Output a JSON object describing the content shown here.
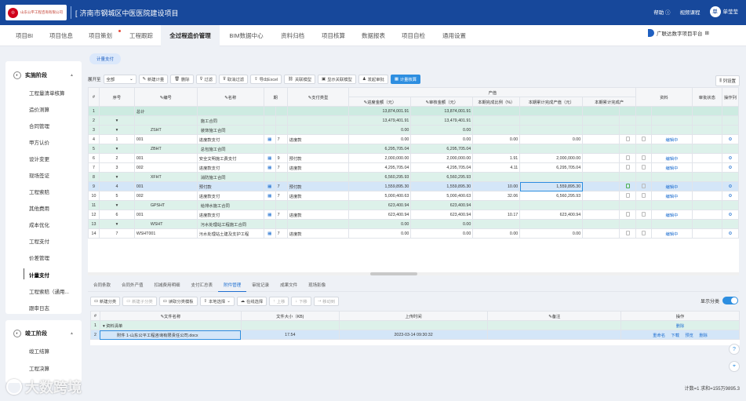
{
  "header": {
    "logo_text": "山东公平工程咨询有限公司",
    "project_title": "济南市钢城区中医医院建设项目",
    "help": "帮助",
    "video": "视频课程",
    "user": "单莹莹",
    "avatar": "单",
    "platform": "广联达数字项目平台"
  },
  "main_tabs": [
    {
      "label": "项目BI"
    },
    {
      "label": "项目信息"
    },
    {
      "label": "项目策划"
    },
    {
      "label": "工程跟踪"
    },
    {
      "label": "全过程造价管理"
    },
    {
      "label": "BIM数据中心"
    },
    {
      "label": "资料归档"
    },
    {
      "label": "项目核算"
    },
    {
      "label": "数据报表"
    },
    {
      "label": "项目自检"
    },
    {
      "label": "通用设置"
    }
  ],
  "sidebar": {
    "group1": "实施阶段",
    "items": [
      "工程量清单核算",
      "造价测算",
      "合同管理",
      "甲方认价",
      "设计变更",
      "现场签证",
      "工程索赔",
      "其他费用",
      "成本优化",
      "工程支付",
      "价差管理",
      "计量支付",
      "工程索赔（通用...",
      "跟审日志"
    ],
    "group2": "竣工阶段",
    "items2": [
      "竣工结算",
      "工程决算"
    ]
  },
  "breadcrumb_tab": "计量支付",
  "toolbar": {
    "expand_label": "展开至",
    "expand_value": "全部",
    "buttons": [
      "新建计量",
      "删除",
      "过滤",
      "取消过滤",
      "导出Excel",
      "关联模型",
      "显示关联模型",
      "发起审批",
      "计量核算"
    ],
    "column_settings": "列设置"
  },
  "grid": {
    "headers": {
      "seq": "序号",
      "code": "编号",
      "name": "名称",
      "pay_type": "支付类型",
      "output_group": "产值",
      "submit_amt": "进度金额（元）",
      "audit_amt": "审核金额（元）",
      "ratio": "本期完成比例（%）",
      "audit_out": "本期累计完成产值（元）",
      "cum_out": "本期累计完成产",
      "docs": "资料",
      "approval": "审批状态",
      "ops": "操作列"
    },
    "rows": [
      {
        "n": "1",
        "seq": "",
        "code": "总计",
        "name": "",
        "num": "",
        "pay": "",
        "submit": "13,874,001.91",
        "audit": "13,874,001.91",
        "ratio": "",
        "out": "",
        "status": "",
        "kind": "total"
      },
      {
        "n": "2",
        "seq": "▾",
        "code": "",
        "name": "施工合同",
        "num": "",
        "pay": "",
        "submit": "13,479,401.91",
        "audit": "13,479,401.91",
        "ratio": "",
        "out": "",
        "status": "",
        "kind": "grp"
      },
      {
        "n": "3",
        "seq": "▾",
        "code": "ZSHT",
        "name": "装饰施工合同",
        "num": "",
        "pay": "",
        "submit": "0.00",
        "audit": "0.00",
        "ratio": "",
        "out": "",
        "status": "",
        "kind": "grp"
      },
      {
        "n": "4",
        "seq": "1",
        "code": "001",
        "name": "进度款支付",
        "num": "7",
        "pay": "进度款",
        "submit": "0.00",
        "audit": "0.00",
        "ratio": "0.00",
        "out": "0.00",
        "status": "编辑中",
        "kind": "row"
      },
      {
        "n": "5",
        "seq": "▾",
        "code": "ZBHT",
        "name": "总包施工合同",
        "num": "",
        "pay": "",
        "submit": "6,295,705.04",
        "audit": "6,295,705.04",
        "ratio": "",
        "out": "",
        "status": "",
        "kind": "grp"
      },
      {
        "n": "6",
        "seq": "2",
        "code": "001",
        "name": "安全文明施工费支付",
        "num": "9",
        "pay": "预付款",
        "submit": "2,000,000.00",
        "audit": "2,000,000.00",
        "ratio": "1.91",
        "out": "2,000,000.00",
        "status": "编辑中",
        "kind": "row"
      },
      {
        "n": "7",
        "seq": "3",
        "code": "002",
        "name": "进度款支付",
        "num": "7",
        "pay": "进度款",
        "submit": "4,295,705.04",
        "audit": "4,295,705.04",
        "ratio": "4.11",
        "out": "6,295,705.04",
        "status": "编辑中",
        "kind": "row"
      },
      {
        "n": "8",
        "seq": "▾",
        "code": "XFHT",
        "name": "消防施工合同",
        "num": "",
        "pay": "",
        "submit": "6,560,295.93",
        "audit": "6,560,295.93",
        "ratio": "",
        "out": "",
        "status": "",
        "kind": "grp"
      },
      {
        "n": "9",
        "seq": "4",
        "code": "001",
        "name": "预付款",
        "num": "7",
        "pay": "预付款",
        "submit": "1,559,895.30",
        "audit": "1,559,895.30",
        "ratio": "10.00",
        "out": "1,559,895.30",
        "status": "编辑中",
        "kind": "sel"
      },
      {
        "n": "10",
        "seq": "5",
        "code": "002",
        "name": "进度款支付",
        "num": "7",
        "pay": "进度款",
        "submit": "5,000,400.63",
        "audit": "5,000,400.63",
        "ratio": "32.06",
        "out": "6,560,295.93",
        "status": "编辑中",
        "kind": "row"
      },
      {
        "n": "11",
        "seq": "▾",
        "code": "GPSHT",
        "name": "给排水施工合同",
        "num": "",
        "pay": "",
        "submit": "623,400.94",
        "audit": "623,400.94",
        "ratio": "",
        "out": "",
        "status": "",
        "kind": "grp"
      },
      {
        "n": "12",
        "seq": "6",
        "code": "001",
        "name": "进度款支付",
        "num": "7",
        "pay": "进度款",
        "submit": "623,400.94",
        "audit": "623,400.94",
        "ratio": "10.17",
        "out": "623,400.94",
        "status": "编辑中",
        "kind": "row"
      },
      {
        "n": "13",
        "seq": "▾",
        "code": "WSHT",
        "name": "污水处理站工程施工合同",
        "num": "",
        "pay": "",
        "submit": "0.00",
        "audit": "0.00",
        "ratio": "",
        "out": "",
        "status": "",
        "kind": "grp"
      },
      {
        "n": "14",
        "seq": "7",
        "code": "WSHT001",
        "name": "污水处理站土建及支护工程",
        "num": "7",
        "pay": "进度款",
        "submit": "0.00",
        "audit": "0.00",
        "ratio": "0.00",
        "out": "0.00",
        "status": "编辑中",
        "kind": "row"
      }
    ]
  },
  "bottom_tabs": [
    "合同条款",
    "合同外产值",
    "扣减费用明细",
    "支付汇总表",
    "附件管理",
    "审批记录",
    "成果文件",
    "现场影像"
  ],
  "bottom_toolbar": [
    "新建分类",
    "新建子分类",
    "读取分类模板",
    "本地选择",
    "在线选择",
    "上移",
    "下移",
    "移动到"
  ],
  "show_classification": "显示分类",
  "files": {
    "headers": {
      "name": "文件名称",
      "size": "文件大小（KB)",
      "time": "上传时间",
      "note": "备注",
      "ops": "操作"
    },
    "rows": [
      {
        "n": "1",
        "name": "▾ 资料清单",
        "size": "",
        "time": "",
        "ops": [
          "删除"
        ],
        "kind": "grp"
      },
      {
        "n": "2",
        "name": "附件 1-山东公平工程咨询有限责任公司.docx",
        "size": "17.54",
        "time": "2023-03-14 09:30:32",
        "ops": [
          "重命名",
          "下载",
          "预览",
          "删除"
        ],
        "kind": "sel"
      }
    ]
  },
  "status": "计数=1 求和=155万9895.3",
  "watermark": "大数跨境"
}
